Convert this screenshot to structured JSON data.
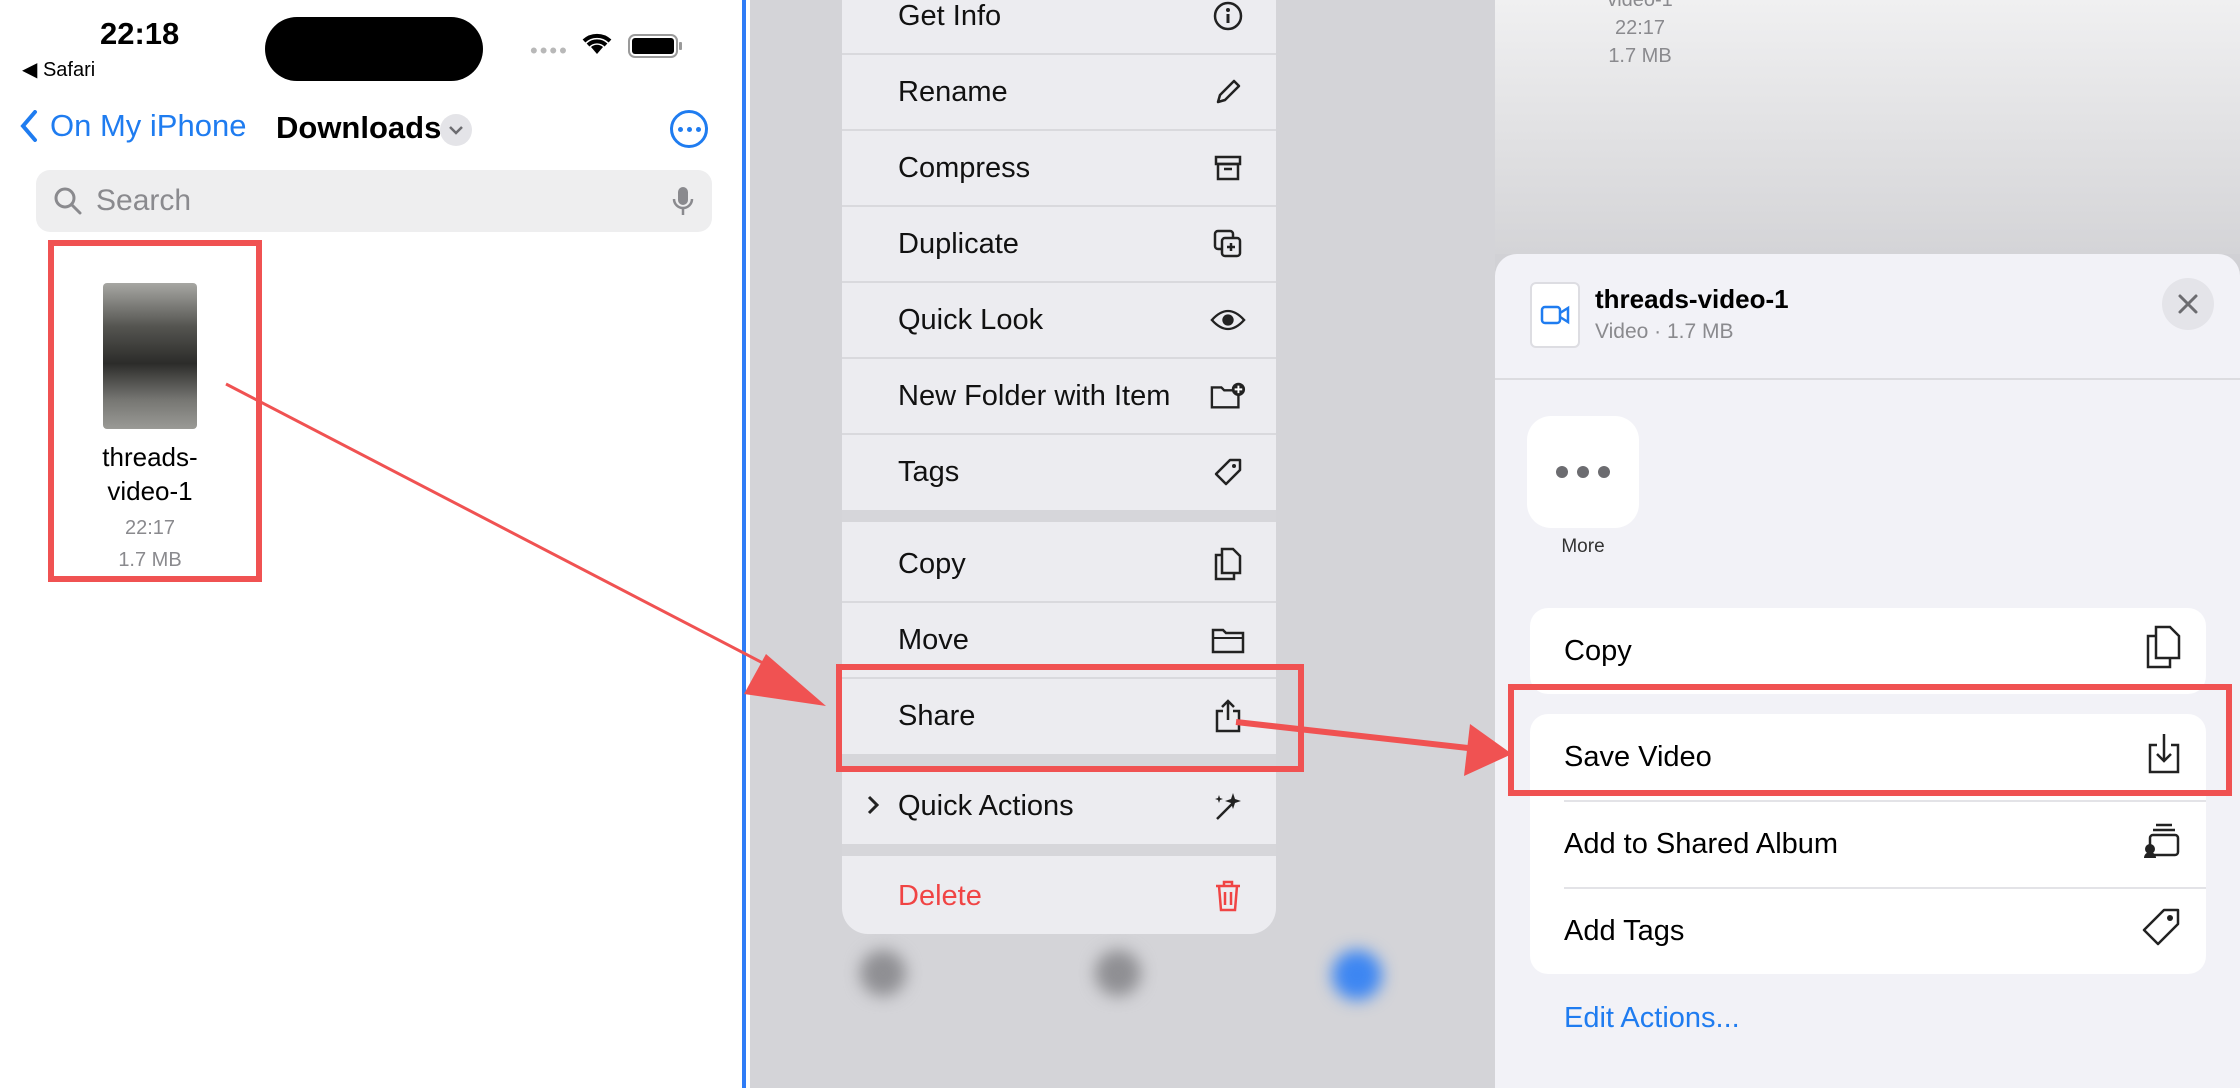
{
  "files_screen": {
    "status_time": "22:18",
    "status_back": "◀ Safari",
    "status_dots": "••••",
    "back_label": "On My iPhone",
    "title": "Downloads",
    "search_placeholder": "Search",
    "file": {
      "name_line1": "threads-",
      "name_line2": "video-1",
      "time": "22:17",
      "size": "1.7 MB"
    }
  },
  "context_menu": {
    "items": [
      {
        "label": "Get Info",
        "icon": "info-icon"
      },
      {
        "label": "Rename",
        "icon": "pencil-icon"
      },
      {
        "label": "Compress",
        "icon": "archive-box-icon"
      },
      {
        "label": "Duplicate",
        "icon": "duplicate-icon"
      },
      {
        "label": "Quick Look",
        "icon": "eye-icon"
      },
      {
        "label": "New Folder with Item",
        "icon": "folder-plus-icon"
      },
      {
        "label": "Tags",
        "icon": "tag-icon"
      },
      {
        "label": "Copy",
        "icon": "copy-icon"
      },
      {
        "label": "Move",
        "icon": "folder-icon"
      },
      {
        "label": "Share",
        "icon": "share-icon"
      },
      {
        "label": "Quick Actions",
        "icon": "sparkles-icon"
      },
      {
        "label": "Delete",
        "icon": "trash-icon"
      }
    ],
    "delete_color": "#f04444"
  },
  "share_sheet": {
    "bg_name": "video-1",
    "bg_time": "22:17",
    "bg_size": "1.7 MB",
    "title": "threads-video-1",
    "subtitle": "Video · 1.7 MB",
    "more_label": "More",
    "actions": [
      {
        "label": "Copy",
        "icon": "copy-icon"
      },
      {
        "label": "Save Video",
        "icon": "save-download-icon"
      },
      {
        "label": "Add to Shared Album",
        "icon": "shared-album-icon"
      },
      {
        "label": "Add Tags",
        "icon": "tag-icon"
      }
    ],
    "edit_actions": "Edit Actions..."
  },
  "colors": {
    "accent": "#1f7cf0",
    "annotation": "#f05252"
  }
}
